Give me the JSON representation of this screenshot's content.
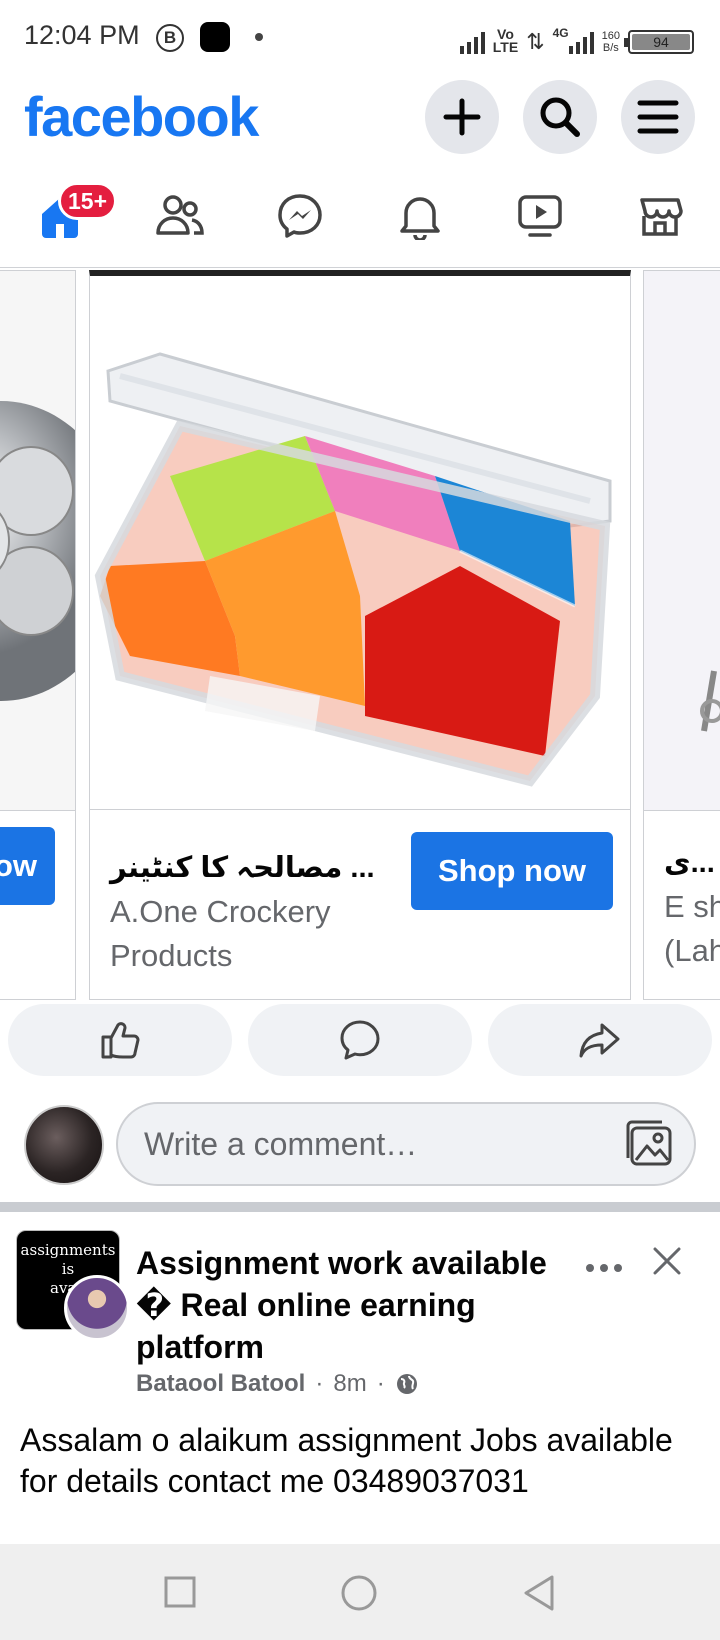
{
  "status_bar": {
    "time": "12:04 PM",
    "b_icon_letter": "B",
    "volte": "Vo\nLTE",
    "network": "4G",
    "speed_value": "160",
    "speed_unit": "B/s",
    "battery": "94"
  },
  "header": {
    "logo": "facebook",
    "icons": [
      "plus-icon",
      "search-icon",
      "menu-icon"
    ]
  },
  "nav": {
    "badge": "15+",
    "tabs": [
      "home",
      "friends",
      "messenger",
      "notifications",
      "video",
      "marketplace"
    ]
  },
  "carousel": {
    "left_card": {
      "button_label": "Shop now",
      "button_visible": "ow"
    },
    "main_card": {
      "title": "مصالحہ کا کنٹینر ...",
      "advertiser": "A.One Crockery Products",
      "button_label": "Shop now"
    },
    "right_card": {
      "title": "ی...",
      "subtitle_line1": "E sh",
      "subtitle_line2": "(Lah"
    }
  },
  "actions": [
    "like-icon",
    "comment-icon",
    "share-icon"
  ],
  "comment": {
    "placeholder": "Write a comment…"
  },
  "post": {
    "page_avatar_text": "assignments\nis\navail",
    "title": "Assignment work available � Real  online earning platform",
    "author": "Bataool Batool",
    "time": "8m",
    "separator": "·",
    "body": "Assalam o alaikum assignment Jobs available for details contact me 03489037031"
  },
  "colors": {
    "brand": "#1877f2",
    "button": "#1b74e4",
    "badge": "#e41e3f",
    "secondary_text": "#65676b"
  }
}
